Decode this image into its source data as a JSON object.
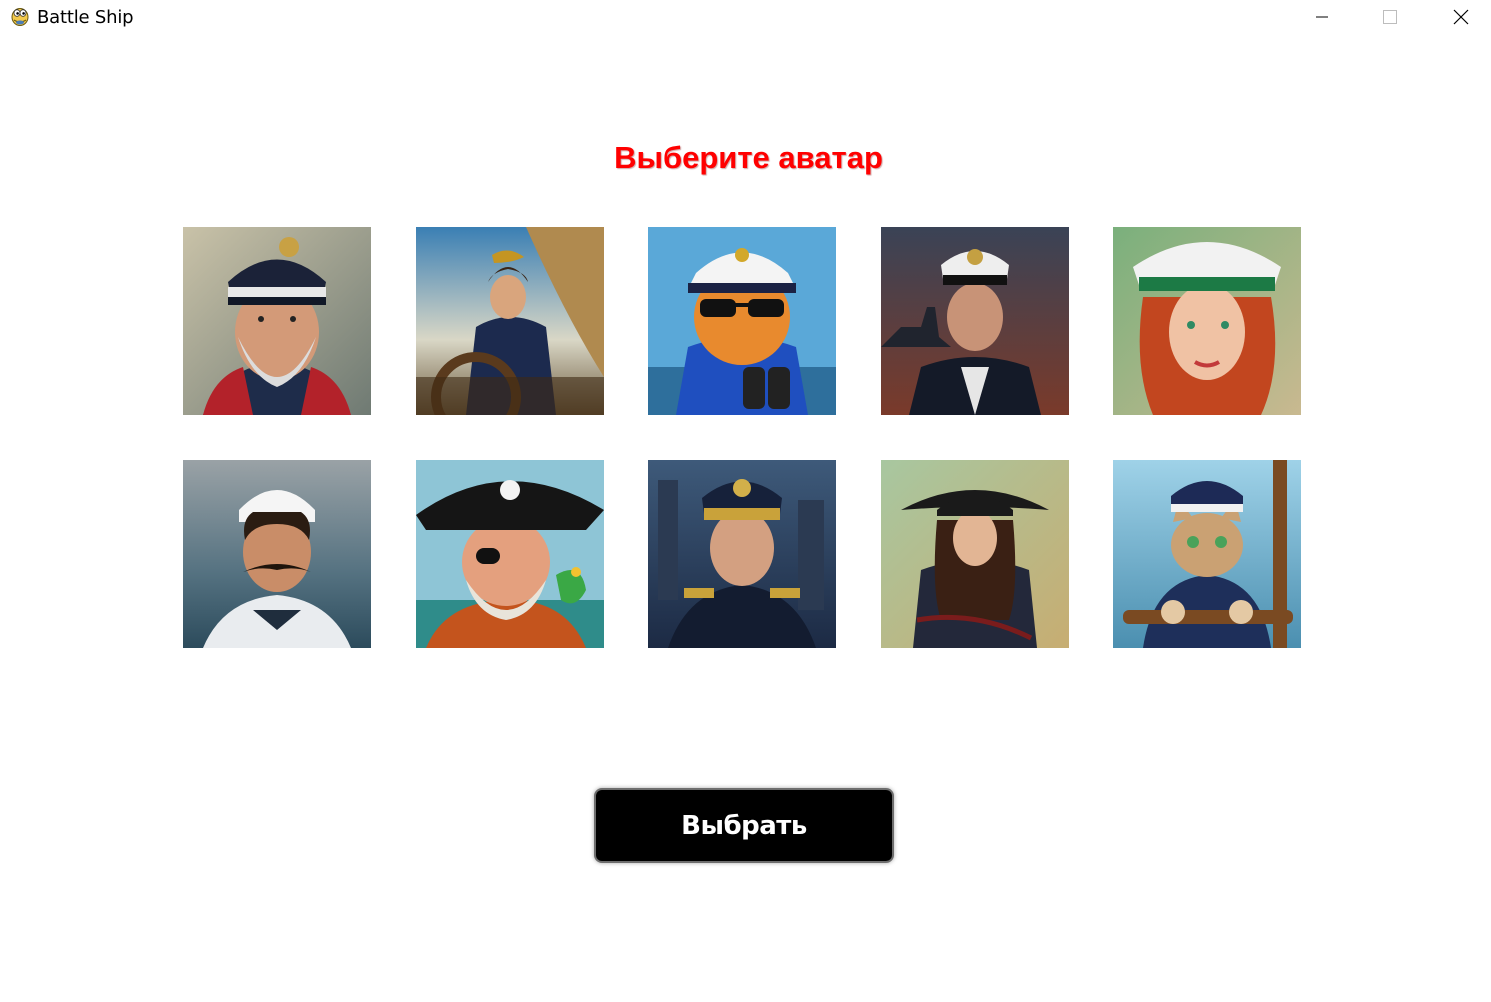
{
  "window": {
    "title": "Battle Ship",
    "icon": "python-snake-icon",
    "controls": [
      "minimize-icon",
      "maximize-icon",
      "close-icon"
    ]
  },
  "main": {
    "heading": "Выберите аватар",
    "select_label": "Выбрать",
    "avatars": [
      {
        "description": "bearded-captain-portrait"
      },
      {
        "description": "woman-sailor-at-helm"
      },
      {
        "description": "cartoon-captain-with-binoculars"
      },
      {
        "description": "naval-officer-with-battleship"
      },
      {
        "description": "redhead-woman-captain"
      },
      {
        "description": "sailor-with-mustache"
      },
      {
        "description": "pirate-with-parrot"
      },
      {
        "description": "modern-naval-officer"
      },
      {
        "description": "woman-pirate"
      },
      {
        "description": "cat-captain"
      }
    ]
  },
  "colors": {
    "heading": "#ff0000",
    "button_bg": "#000000",
    "button_text": "#ffffff",
    "background": "#ffffff"
  }
}
